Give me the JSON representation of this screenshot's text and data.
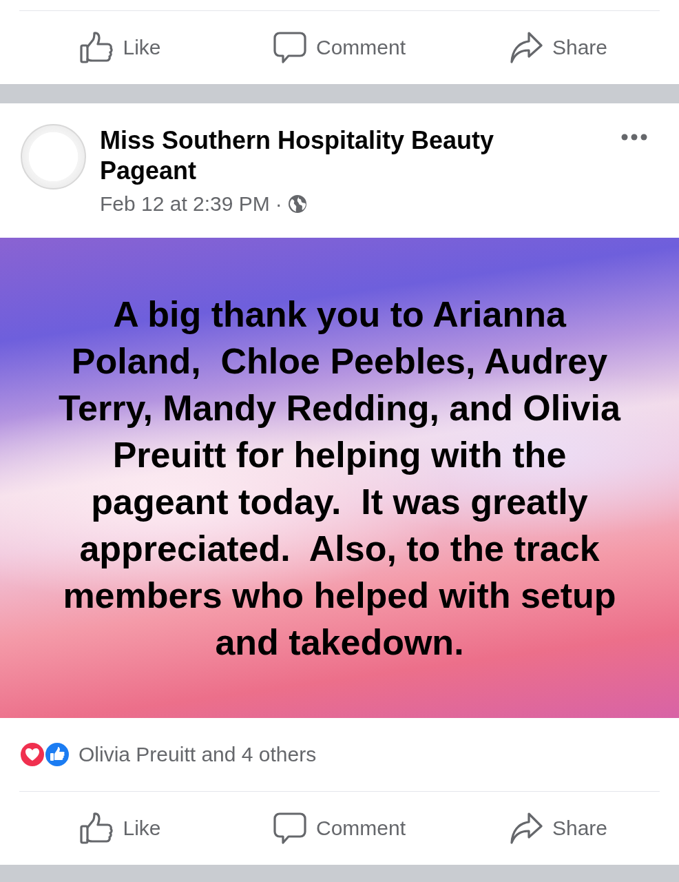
{
  "top_actions": [
    {
      "label": "Like",
      "kind": "like"
    },
    {
      "label": "Comment",
      "kind": "comment"
    },
    {
      "label": "Share",
      "kind": "share"
    }
  ],
  "post": {
    "author": "Miss Southern Hospitality Beauty Pageant",
    "timestamp": "Feb 12 at 2:39 PM",
    "separator": "·",
    "public": true,
    "text": "A big thank you to Arianna Poland,  Chloe Peebles, Audrey Terry, Mandy Redding, and Olivia Preuitt for helping with the pageant today.  It was greatly appreciated.  Also, to the track members who helped with setup and takedown.",
    "reactions": [
      {
        "kind": "love"
      },
      {
        "kind": "like"
      }
    ],
    "reaction_summary": "Olivia Preuitt and 4 others",
    "actions": [
      {
        "label": "Like",
        "kind": "like"
      },
      {
        "label": "Comment",
        "kind": "comment"
      },
      {
        "label": "Share",
        "kind": "share"
      }
    ]
  }
}
